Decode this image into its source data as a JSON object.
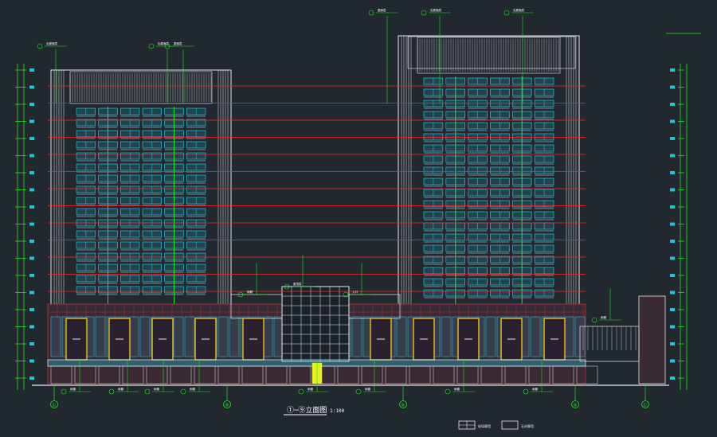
{
  "drawing": {
    "title": "①~⑨立面图",
    "scale": "1:100",
    "colors": {
      "background": "#212830",
      "outline": "#e8e8e8",
      "glass": "#22c4d8",
      "floor_line": "#ff2a2a",
      "dimension": "#1ee61e",
      "podium_fill": "#3a2a36",
      "podium_grid": "#a0303c",
      "door_frame": "#f0c020",
      "yellow_panel": "#e4f020",
      "text": "#ffffff"
    },
    "axis_labels": [
      "①",
      "⑨",
      "⑨",
      "⑨",
      "①"
    ],
    "callouts": [
      "出屋面层",
      "出屋面层",
      "屋面层",
      "屋面层",
      "出屋面层",
      "出屋面层",
      "屋顶层",
      "雨棚",
      "入口",
      "雨棚",
      "雨棚",
      "雨棚",
      "雨棚",
      "雨棚",
      "雨棚",
      "雨棚",
      "雨棚",
      "雨棚"
    ],
    "legend": {
      "item1_label": "玻璃幕墙",
      "item2_label": "石材幕墙"
    }
  }
}
